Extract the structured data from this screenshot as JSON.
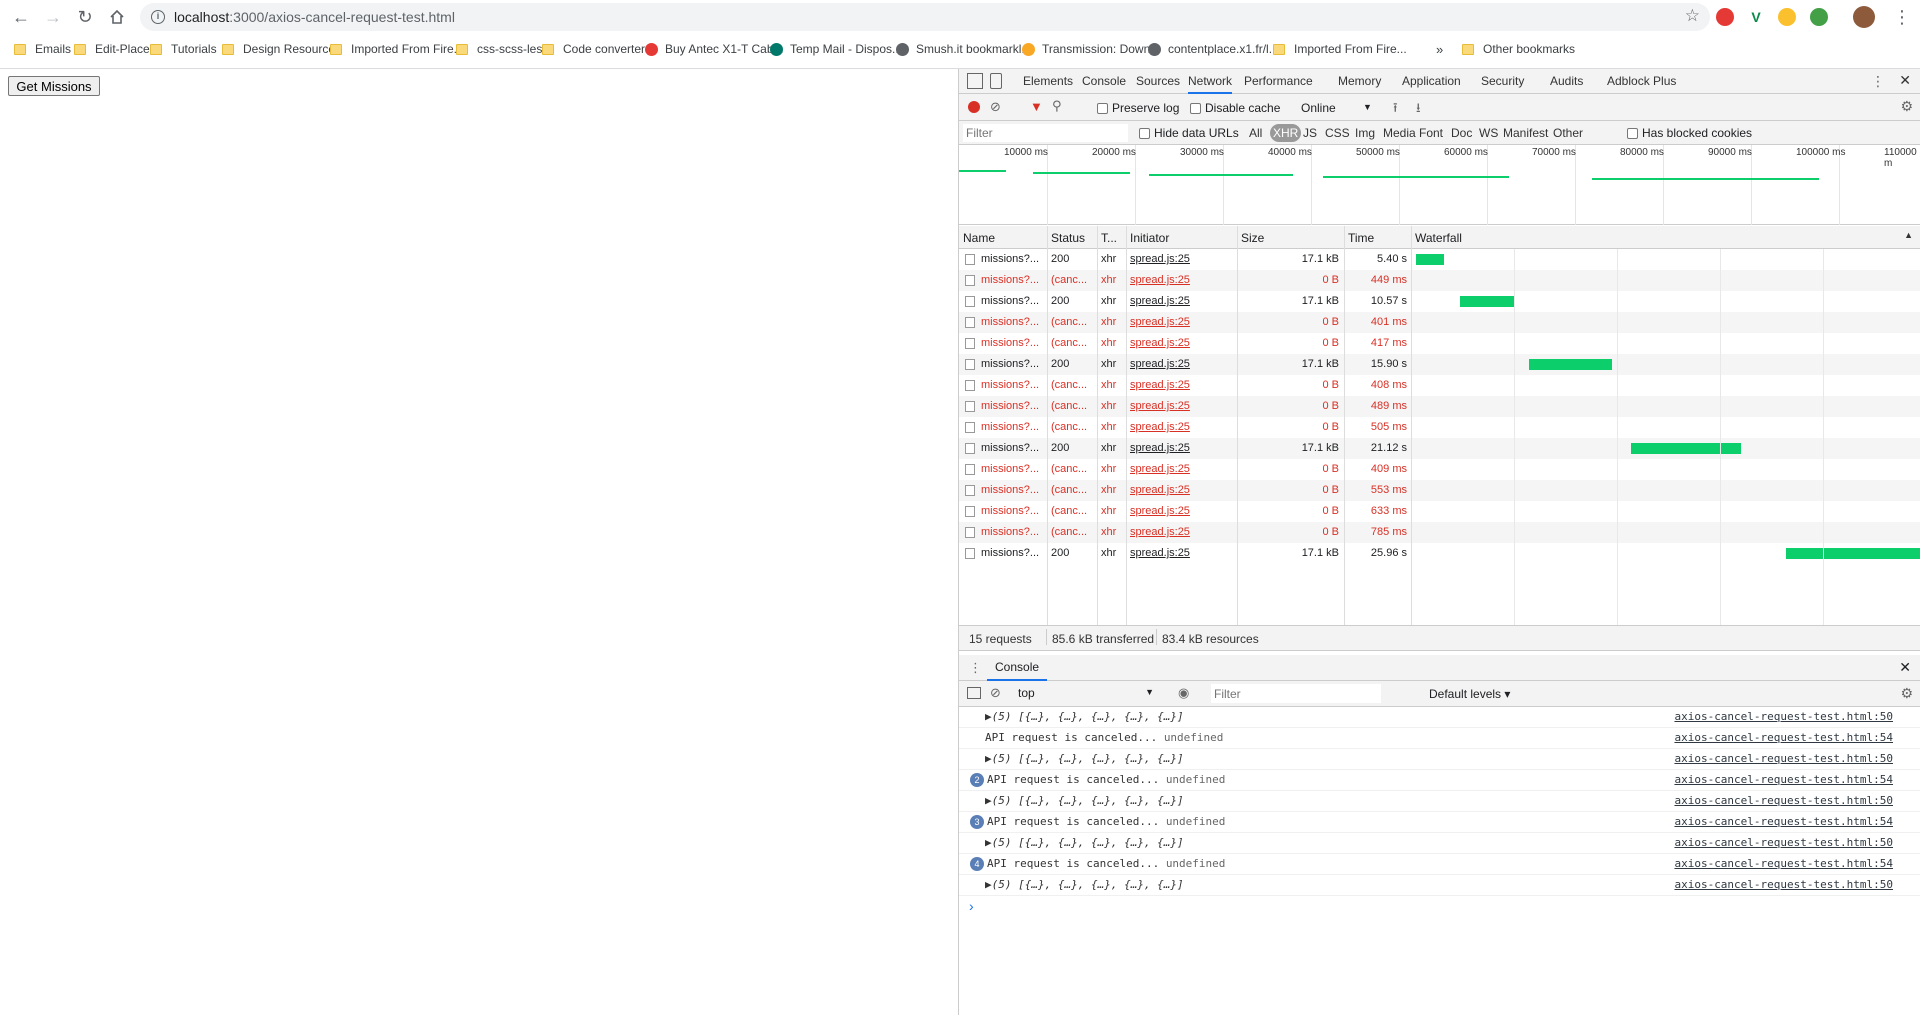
{
  "browser": {
    "url_host": "localhost",
    "url_path": ":3000/axios-cancel-request-test.html",
    "bookmarks": [
      "Emails",
      "Edit-Place",
      "Tutorials",
      "Design Resources",
      "Imported From Fire...",
      "css-scss-less",
      "Code converters",
      "Buy Antec X1-T Cab...",
      "Temp Mail - Dispos...",
      "Smush.it bookmarkl...",
      "Transmission: Down...",
      "contentplace.x1.fr/l...",
      "Imported From Fire..."
    ],
    "overflow": "»",
    "other_bookmarks": "Other bookmarks"
  },
  "page": {
    "button_label": "Get Missions"
  },
  "devtools": {
    "tabs": [
      "Elements",
      "Console",
      "Sources",
      "Network",
      "Performance",
      "Memory",
      "Application",
      "Security",
      "Audits",
      "Adblock Plus"
    ],
    "active_tab": "Network",
    "toolbar": {
      "preserve_log": "Preserve log",
      "disable_cache": "Disable cache",
      "throttle": "Online"
    },
    "filter": {
      "placeholder": "Filter",
      "hide_data_urls": "Hide data URLs",
      "types": [
        "All",
        "XHR",
        "JS",
        "CSS",
        "Img",
        "Media",
        "Font",
        "Doc",
        "WS",
        "Manifest",
        "Other"
      ],
      "active_type": "XHR",
      "blocked": "Has blocked cookies"
    },
    "overview_ticks": [
      "10000 ms",
      "20000 ms",
      "30000 ms",
      "40000 ms",
      "50000 ms",
      "60000 ms",
      "70000 ms",
      "80000 ms",
      "90000 ms",
      "100000 ms",
      "110000 m"
    ],
    "columns": [
      "Name",
      "Status",
      "T...",
      "Initiator",
      "Size",
      "Time",
      "Waterfall"
    ],
    "requests": [
      {
        "name": "missions?...",
        "status": "200",
        "type": "xhr",
        "initiator": "spread.js:25",
        "size": "17.1 kB",
        "time": "5.40 s",
        "canceled": false,
        "bar_start": 0.01,
        "bar_width": 0.055
      },
      {
        "name": "missions?...",
        "status": "(canc...",
        "type": "xhr",
        "initiator": "spread.js:25",
        "size": "0 B",
        "time": "449 ms",
        "canceled": true
      },
      {
        "name": "missions?...",
        "status": "200",
        "type": "xhr",
        "initiator": "spread.js:25",
        "size": "17.1 kB",
        "time": "10.57 s",
        "canceled": false,
        "bar_start": 0.097,
        "bar_width": 0.107
      },
      {
        "name": "missions?...",
        "status": "(canc...",
        "type": "xhr",
        "initiator": "spread.js:25",
        "size": "0 B",
        "time": "401 ms",
        "canceled": true
      },
      {
        "name": "missions?...",
        "status": "(canc...",
        "type": "xhr",
        "initiator": "spread.js:25",
        "size": "0 B",
        "time": "417 ms",
        "canceled": true
      },
      {
        "name": "missions?...",
        "status": "200",
        "type": "xhr",
        "initiator": "spread.js:25",
        "size": "17.1 kB",
        "time": "15.90 s",
        "canceled": false,
        "bar_start": 0.232,
        "bar_width": 0.163
      },
      {
        "name": "missions?...",
        "status": "(canc...",
        "type": "xhr",
        "initiator": "spread.js:25",
        "size": "0 B",
        "time": "408 ms",
        "canceled": true
      },
      {
        "name": "missions?...",
        "status": "(canc...",
        "type": "xhr",
        "initiator": "spread.js:25",
        "size": "0 B",
        "time": "489 ms",
        "canceled": true
      },
      {
        "name": "missions?...",
        "status": "(canc...",
        "type": "xhr",
        "initiator": "spread.js:25",
        "size": "0 B",
        "time": "505 ms",
        "canceled": true
      },
      {
        "name": "missions?...",
        "status": "200",
        "type": "xhr",
        "initiator": "spread.js:25",
        "size": "17.1 kB",
        "time": "21.12 s",
        "canceled": false,
        "bar_start": 0.431,
        "bar_width": 0.216
      },
      {
        "name": "missions?...",
        "status": "(canc...",
        "type": "xhr",
        "initiator": "spread.js:25",
        "size": "0 B",
        "time": "409 ms",
        "canceled": true
      },
      {
        "name": "missions?...",
        "status": "(canc...",
        "type": "xhr",
        "initiator": "spread.js:25",
        "size": "0 B",
        "time": "553 ms",
        "canceled": true
      },
      {
        "name": "missions?...",
        "status": "(canc...",
        "type": "xhr",
        "initiator": "spread.js:25",
        "size": "0 B",
        "time": "633 ms",
        "canceled": true
      },
      {
        "name": "missions?...",
        "status": "(canc...",
        "type": "xhr",
        "initiator": "spread.js:25",
        "size": "0 B",
        "time": "785 ms",
        "canceled": true
      },
      {
        "name": "missions?...",
        "status": "200",
        "type": "xhr",
        "initiator": "spread.js:25",
        "size": "17.1 kB",
        "time": "25.96 s",
        "canceled": false,
        "bar_start": 0.736,
        "bar_width": 0.264
      }
    ],
    "summary": {
      "requests": "15 requests",
      "transferred": "85.6 kB transferred",
      "resources": "83.4 kB resources"
    },
    "console": {
      "tab": "Console",
      "context": "top",
      "filter_placeholder": "Filter",
      "levels": "Default levels ▾",
      "lines": [
        {
          "badge": "",
          "text": "▶(5) [{…}, {…}, {…}, {…}, {…}]",
          "src": "axios-cancel-request-test.html:50"
        },
        {
          "badge": "",
          "text": "API request is canceled... ",
          "extra": "undefined",
          "src": "axios-cancel-request-test.html:54"
        },
        {
          "badge": "",
          "text": "▶(5) [{…}, {…}, {…}, {…}, {…}]",
          "src": "axios-cancel-request-test.html:50"
        },
        {
          "badge": "2",
          "text": "API request is canceled... ",
          "extra": "undefined",
          "src": "axios-cancel-request-test.html:54"
        },
        {
          "badge": "",
          "text": "▶(5) [{…}, {…}, {…}, {…}, {…}]",
          "src": "axios-cancel-request-test.html:50"
        },
        {
          "badge": "3",
          "text": "API request is canceled... ",
          "extra": "undefined",
          "src": "axios-cancel-request-test.html:54"
        },
        {
          "badge": "",
          "text": "▶(5) [{…}, {…}, {…}, {…}, {…}]",
          "src": "axios-cancel-request-test.html:50"
        },
        {
          "badge": "4",
          "text": "API request is canceled... ",
          "extra": "undefined",
          "src": "axios-cancel-request-test.html:54"
        },
        {
          "badge": "",
          "text": "▶(5) [{…}, {…}, {…}, {…}, {…}]",
          "src": "axios-cancel-request-test.html:50"
        }
      ],
      "prompt": "›"
    },
    "colors": {
      "accent": "#1a73e8",
      "error": "#d93025",
      "bar": "#0cce6b",
      "badge": "#5a7fb6"
    }
  }
}
